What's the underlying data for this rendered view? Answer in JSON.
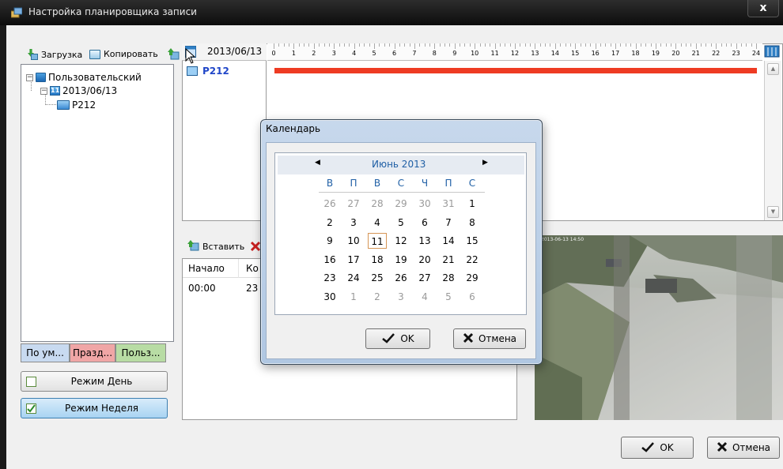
{
  "window": {
    "title": "Настройка планировщика записи",
    "close": "x"
  },
  "toolbar": {
    "load": "Загрузка",
    "copy": "Копировать"
  },
  "tree": {
    "root": "Пользовательский",
    "date": "2013/06/13",
    "camera": "P212"
  },
  "tabs": [
    "По ум...",
    "Празд...",
    "Польз..."
  ],
  "modes": {
    "day": "Режим День",
    "week": "Режим Неделя"
  },
  "timeline": {
    "date": "2013/06/13",
    "camera": "P212",
    "hours": [
      "0",
      "1",
      "2",
      "3",
      "4",
      "5",
      "6",
      "7",
      "8",
      "9",
      "10",
      "11",
      "12",
      "13",
      "14",
      "15",
      "16",
      "17",
      "18",
      "19",
      "20",
      "21",
      "22",
      "23",
      "24"
    ],
    "recording_color": "#ee3b23"
  },
  "schedule": {
    "paste": "Вставить",
    "columns": [
      "Начало",
      "Ко"
    ],
    "rows": [
      [
        "00:00",
        "23"
      ]
    ]
  },
  "video": {
    "overlay": "2013-06-13 14:50"
  },
  "footer": {
    "ok": "OK",
    "cancel": "Отмена"
  },
  "calendar": {
    "title": "Календарь",
    "month": "Июнь 2013",
    "prev": "◀",
    "next": "▶",
    "weekdays": [
      "В",
      "П",
      "В",
      "С",
      "Ч",
      "П",
      "С"
    ],
    "weeks": [
      [
        "26",
        "27",
        "28",
        "29",
        "30",
        "31",
        "1"
      ],
      [
        "2",
        "3",
        "4",
        "5",
        "6",
        "7",
        "8"
      ],
      [
        "9",
        "10",
        "11",
        "12",
        "13",
        "14",
        "15"
      ],
      [
        "16",
        "17",
        "18",
        "19",
        "20",
        "21",
        "22"
      ],
      [
        "23",
        "24",
        "25",
        "26",
        "27",
        "28",
        "29"
      ],
      [
        "30",
        "1",
        "2",
        "3",
        "4",
        "5",
        "6"
      ]
    ],
    "selected_day": "11",
    "ok": "OK",
    "cancel": "Отмена"
  }
}
